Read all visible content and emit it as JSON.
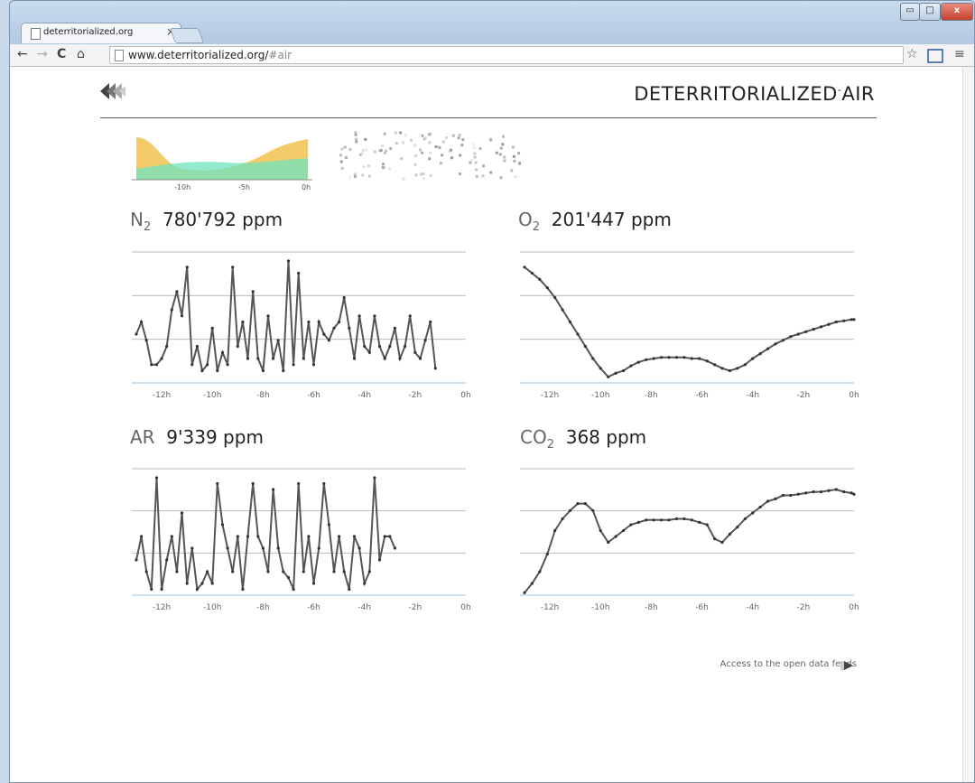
{
  "browser": {
    "tab_title": "deterritorialized.org",
    "tab_close": "×",
    "url_host": "www.deterritorialized.org/",
    "url_hash": "#air",
    "window_controls": {
      "minimize": "▭",
      "maximize": "□",
      "close": "x"
    },
    "nav": {
      "back": "←",
      "forward": "→",
      "reload": "C",
      "home": "⌂"
    },
    "star": "☆",
    "menu": "≡"
  },
  "header": {
    "title": "DETERRITORIALIZED",
    "title_sup": "-",
    "title_suffix": "AIR"
  },
  "mini_chart": {
    "ticks": [
      "-10h",
      "-5h",
      "0h"
    ],
    "colors": {
      "series_a": "#f1c24d",
      "series_b": "#6fe3c0"
    }
  },
  "panels": {
    "n2": {
      "chem": "N",
      "sub": "2",
      "value": "780'792 ppm"
    },
    "o2": {
      "chem": "O",
      "sub": "2",
      "value": "201'447 ppm"
    },
    "ar": {
      "chem": "AR",
      "sub": "",
      "value": "9'339 ppm"
    },
    "co2": {
      "chem": "CO",
      "sub": "2",
      "value": "368 ppm"
    }
  },
  "footer": {
    "link_label": "Access to the open data feeds"
  },
  "chart_data": [
    {
      "id": "n2",
      "type": "line",
      "x": [
        -13,
        -12.8,
        -12.6,
        -12.4,
        -12.2,
        -12,
        -11.8,
        -11.6,
        -11.4,
        -11.2,
        -11,
        -10.8,
        -10.6,
        -10.4,
        -10.2,
        -10,
        -9.8,
        -9.6,
        -9.4,
        -9.2,
        -9,
        -8.8,
        -8.6,
        -8.4,
        -8.2,
        -8,
        -7.8,
        -7.6,
        -7.4,
        -7.2,
        -7,
        -6.8,
        -6.6,
        -6.4,
        -6.2,
        -6,
        -5.8,
        -5.6,
        -5.4,
        -5.2,
        -5,
        -4.8,
        -4.6,
        -4.4,
        -4.2,
        -4,
        -3.8,
        -3.6,
        -3.4,
        -3.2,
        -3,
        -2.8,
        -2.6,
        -2.4,
        -2.2,
        -2,
        -1.8,
        -1.6,
        -1.4,
        -1.2,
        -1,
        -0.8,
        -0.6,
        -0.4,
        -0.2,
        0
      ],
      "y": [
        0.4,
        0.5,
        0.35,
        0.15,
        0.15,
        0.2,
        0.3,
        0.6,
        0.75,
        0.55,
        0.95,
        0.15,
        0.3,
        0.1,
        0.15,
        0.45,
        0.1,
        0.25,
        0.15,
        0.95,
        0.3,
        0.5,
        0.2,
        0.75,
        0.2,
        0.1,
        0.55,
        0.2,
        0.35,
        0.1,
        1.0,
        0.15,
        0.9,
        0.2,
        0.5,
        0.15,
        0.5,
        0.4,
        0.35,
        0.45,
        0.5,
        0.7,
        0.45,
        0.2,
        0.55,
        0.3,
        0.25,
        0.55,
        0.3,
        0.2,
        0.3,
        0.45,
        0.2,
        0.3,
        0.55,
        0.25,
        0.2,
        0.35,
        0.5,
        0.12
      ],
      "xlim": [
        -13,
        0
      ],
      "x_tick_labels": [
        "-12h",
        "-10h",
        "-8h",
        "-6h",
        "-4h",
        "-2h",
        "0h"
      ],
      "grid": true
    },
    {
      "id": "o2",
      "type": "line",
      "x": [
        -13,
        -12.7,
        -12.4,
        -12.1,
        -11.8,
        -11.5,
        -11.2,
        -10.9,
        -10.6,
        -10.3,
        -10,
        -9.7,
        -9.4,
        -9.1,
        -8.8,
        -8.5,
        -8.2,
        -7.9,
        -7.6,
        -7.3,
        -7,
        -6.7,
        -6.4,
        -6.1,
        -5.8,
        -5.5,
        -5.2,
        -4.9,
        -4.6,
        -4.3,
        -4,
        -3.7,
        -3.4,
        -3.1,
        -2.8,
        -2.5,
        -2.2,
        -1.9,
        -1.6,
        -1.3,
        -1,
        -0.7,
        -0.4,
        -0.1,
        0
      ],
      "y": [
        0.95,
        0.9,
        0.85,
        0.78,
        0.7,
        0.6,
        0.5,
        0.4,
        0.3,
        0.2,
        0.12,
        0.05,
        0.08,
        0.1,
        0.14,
        0.17,
        0.19,
        0.2,
        0.21,
        0.21,
        0.21,
        0.21,
        0.2,
        0.2,
        0.18,
        0.15,
        0.12,
        0.1,
        0.12,
        0.15,
        0.2,
        0.24,
        0.28,
        0.32,
        0.35,
        0.38,
        0.4,
        0.42,
        0.44,
        0.46,
        0.48,
        0.5,
        0.51,
        0.52,
        0.52
      ],
      "xlim": [
        -13,
        0
      ],
      "x_tick_labels": [
        "-12h",
        "-10h",
        "-8h",
        "-6h",
        "-4h",
        "-2h",
        "0h"
      ],
      "grid": true
    },
    {
      "id": "ar",
      "type": "line",
      "x": [
        -13,
        -12.8,
        -12.6,
        -12.4,
        -12.2,
        -12,
        -11.8,
        -11.6,
        -11.4,
        -11.2,
        -11,
        -10.8,
        -10.6,
        -10.4,
        -10.2,
        -10,
        -9.8,
        -9.6,
        -9.4,
        -9.2,
        -9,
        -8.8,
        -8.6,
        -8.4,
        -8.2,
        -8,
        -7.8,
        -7.6,
        -7.4,
        -7.2,
        -7,
        -6.8,
        -6.6,
        -6.4,
        -6.2,
        -6,
        -5.8,
        -5.6,
        -5.4,
        -5.2,
        -5,
        -4.8,
        -4.6,
        -4.4,
        -4.2,
        -4,
        -3.8,
        -3.6,
        -3.4,
        -3.2,
        -3,
        -2.8,
        -2.6,
        -2.4,
        -2.2,
        -2,
        -1.8,
        -1.6,
        -1.4,
        -1.2,
        -1,
        -0.8,
        -0.6,
        -0.4,
        -0.2,
        0
      ],
      "y": [
        0.3,
        0.5,
        0.2,
        0.05,
        1.0,
        0.05,
        0.3,
        0.5,
        0.2,
        0.7,
        0.1,
        0.4,
        0.05,
        0.1,
        0.2,
        0.1,
        0.95,
        0.6,
        0.4,
        0.2,
        0.5,
        0.05,
        0.5,
        0.95,
        0.5,
        0.4,
        0.2,
        0.9,
        0.4,
        0.2,
        0.15,
        0.05,
        0.95,
        0.2,
        0.5,
        0.1,
        0.4,
        0.95,
        0.6,
        0.2,
        0.5,
        0.2,
        0.05,
        0.5,
        0.4,
        0.1,
        0.2,
        1.0,
        0.3,
        0.5,
        0.5,
        0.4
      ],
      "xlim": [
        -13,
        0
      ],
      "x_tick_labels": [
        "-12h",
        "-10h",
        "-8h",
        "-6h",
        "-4h",
        "-2h",
        "0h"
      ],
      "grid": true
    },
    {
      "id": "co2",
      "type": "line",
      "x": [
        -13,
        -12.7,
        -12.4,
        -12.1,
        -11.8,
        -11.5,
        -11.2,
        -10.9,
        -10.6,
        -10.3,
        -10,
        -9.7,
        -9.4,
        -9.1,
        -8.8,
        -8.5,
        -8.2,
        -7.9,
        -7.6,
        -7.3,
        -7,
        -6.7,
        -6.4,
        -6.1,
        -5.8,
        -5.5,
        -5.2,
        -4.9,
        -4.6,
        -4.3,
        -4,
        -3.7,
        -3.4,
        -3.1,
        -2.8,
        -2.5,
        -2.2,
        -1.9,
        -1.6,
        -1.3,
        -1,
        -0.7,
        -0.4,
        -0.1,
        0
      ],
      "y": [
        0.02,
        0.1,
        0.2,
        0.35,
        0.55,
        0.65,
        0.72,
        0.78,
        0.78,
        0.72,
        0.55,
        0.45,
        0.5,
        0.55,
        0.6,
        0.62,
        0.64,
        0.64,
        0.64,
        0.64,
        0.65,
        0.65,
        0.64,
        0.62,
        0.6,
        0.48,
        0.45,
        0.52,
        0.58,
        0.65,
        0.7,
        0.75,
        0.8,
        0.82,
        0.85,
        0.85,
        0.86,
        0.87,
        0.88,
        0.88,
        0.89,
        0.9,
        0.88,
        0.87,
        0.86
      ],
      "xlim": [
        -13,
        0
      ],
      "x_tick_labels": [
        "-12h",
        "-10h",
        "-8h",
        "-6h",
        "-4h",
        "-2h",
        "0h"
      ],
      "grid": true
    }
  ]
}
